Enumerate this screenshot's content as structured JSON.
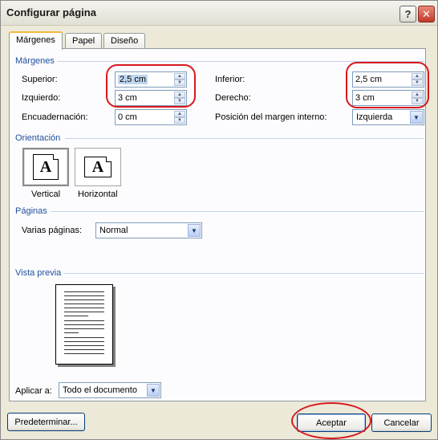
{
  "window": {
    "title": "Configurar página"
  },
  "tabs": [
    {
      "label": "Márgenes",
      "active": true
    },
    {
      "label": "Papel",
      "active": false
    },
    {
      "label": "Diseño",
      "active": false
    }
  ],
  "margins": {
    "group_label": "Márgenes",
    "superior": {
      "label": "Superior:",
      "value": "2,5 cm"
    },
    "inferior": {
      "label": "Inferior:",
      "value": "2,5 cm"
    },
    "izquierdo": {
      "label": "Izquierdo:",
      "value": "3 cm"
    },
    "derecho": {
      "label": "Derecho:",
      "value": "3 cm"
    },
    "encuadernacion": {
      "label": "Encuadernación:",
      "value": "0 cm"
    },
    "posicion": {
      "label": "Posición del margen interno:",
      "value": "Izquierda"
    }
  },
  "orientation": {
    "group_label": "Orientación",
    "vertical": {
      "label": "Vertical",
      "icon_letter": "A",
      "selected": true
    },
    "horizontal": {
      "label": "Horizontal",
      "icon_letter": "A",
      "selected": false
    }
  },
  "pages": {
    "group_label": "Páginas",
    "multiple": {
      "label": "Varias páginas:",
      "value": "Normal"
    }
  },
  "preview": {
    "group_label": "Vista previa"
  },
  "apply": {
    "label": "Aplicar a:",
    "value": "Todo el documento"
  },
  "buttons": {
    "default": "Predeterminar...",
    "accept": "Aceptar",
    "cancel": "Cancelar"
  },
  "colors": {
    "group_label": "#1f4e99",
    "highlight": "#d8181e",
    "titlebar_close": "#c0392b"
  }
}
